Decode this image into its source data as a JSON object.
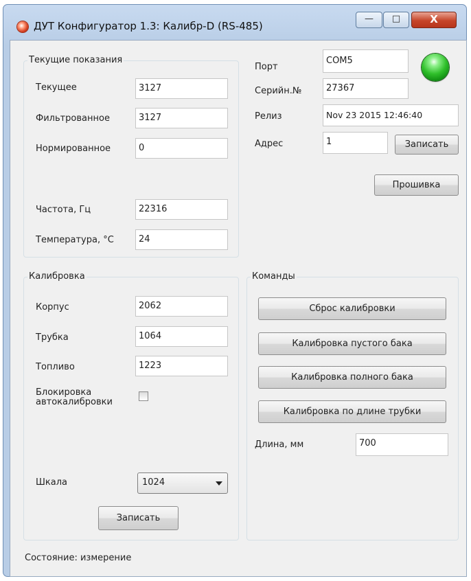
{
  "window": {
    "title": "ДУТ Конфигуратор 1.3: Калибр-D (RS-485)",
    "controls": {
      "minimize": "—",
      "maximize": "□",
      "close": "X"
    }
  },
  "readings": {
    "title": "Текущие показания",
    "current_label": "Текущее",
    "current_value": "3127",
    "filtered_label": "Фильтрованное",
    "filtered_value": "3127",
    "normalized_label": "Нормированное",
    "normalized_value": "0",
    "frequency_label": "Частота, Гц",
    "frequency_value": "22316",
    "temperature_label": "Температура, °С",
    "temperature_value": "24"
  },
  "device": {
    "port_label": "Порт",
    "port_value": "COM5",
    "serial_label": "Серийн.№",
    "serial_value": "27367",
    "release_label": "Релиз",
    "release_value": "Nov 23 2015 12:46:40",
    "address_label": "Адрес",
    "address_value": "1",
    "write_button": "Записать",
    "firmware_button": "Прошивка",
    "led_color": "#2fbf2a"
  },
  "calibration": {
    "title": "Калибровка",
    "body_label": "Корпус",
    "body_value": "2062",
    "tube_label": "Трубка",
    "tube_value": "1064",
    "fuel_label": "Топливо",
    "fuel_value": "1223",
    "autocal_label_line1": "Блокировка",
    "autocal_label_line2": "автокалибровки",
    "autocal_checked": false,
    "scale_label": "Шкала",
    "scale_value": "1024",
    "write_button": "Записать"
  },
  "commands": {
    "title": "Команды",
    "reset_button": "Сброс калибровки",
    "empty_button": "Калибровка пустого бака",
    "full_button": "Калибровка полного бака",
    "length_button": "Калибровка по длине трубки",
    "length_label": "Длина, мм",
    "length_value": "700"
  },
  "status": {
    "text": "Состояние:  измерение"
  }
}
